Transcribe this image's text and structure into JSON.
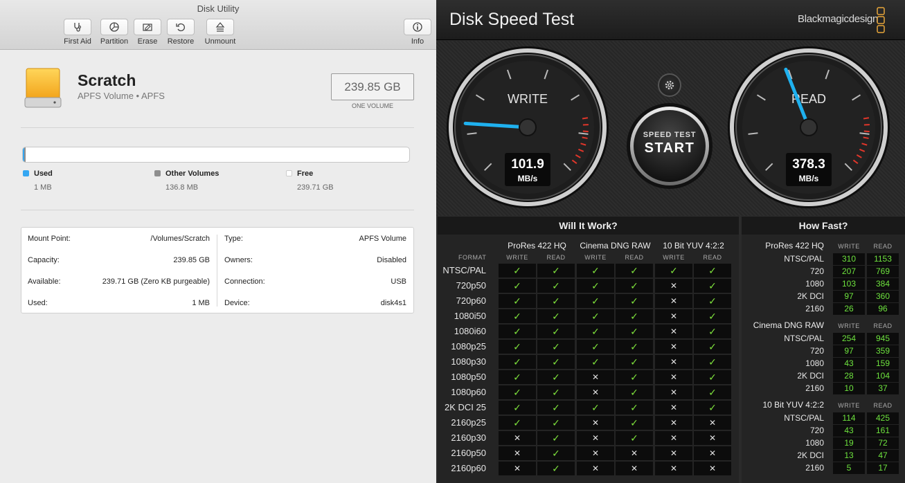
{
  "disk_utility": {
    "window_title": "Disk Utility",
    "toolbar": [
      {
        "label": "First Aid",
        "icon": "stethoscope-icon"
      },
      {
        "label": "Partition",
        "icon": "pie-icon"
      },
      {
        "label": "Erase",
        "icon": "erase-icon"
      },
      {
        "label": "Restore",
        "icon": "restore-icon"
      },
      {
        "label": "Unmount",
        "icon": "eject-icon"
      },
      {
        "label": "Info",
        "icon": "info-icon"
      }
    ],
    "volume": {
      "name": "Scratch",
      "subtitle": "APFS Volume • APFS",
      "size": "239.85 GB",
      "size_caption": "ONE VOLUME"
    },
    "usage": {
      "used_fraction": 0.003,
      "other_fraction": 0.004,
      "colors": {
        "used": "#35a7f2",
        "other": "#8e8e8e",
        "free": "#ffffff"
      },
      "legend": [
        {
          "label": "Used",
          "value": "1 MB"
        },
        {
          "label": "Other Volumes",
          "value": "136.8 MB"
        },
        {
          "label": "Free",
          "value": "239.71 GB"
        }
      ]
    },
    "info": {
      "left": [
        {
          "key": "Mount Point:",
          "value": "/Volumes/Scratch"
        },
        {
          "key": "Capacity:",
          "value": "239.85 GB"
        },
        {
          "key": "Available:",
          "value": "239.71 GB (Zero KB purgeable)"
        },
        {
          "key": "Used:",
          "value": "1 MB"
        }
      ],
      "right": [
        {
          "key": "Type:",
          "value": "APFS Volume"
        },
        {
          "key": "Owners:",
          "value": "Disabled"
        },
        {
          "key": "Connection:",
          "value": "USB"
        },
        {
          "key": "Device:",
          "value": "disk4s1"
        }
      ]
    }
  },
  "speed_test": {
    "title": "Disk Speed Test",
    "brand": "Blackmagicdesign",
    "accent_color": "#1fb1ef",
    "write_gauge": {
      "label": "WRITE",
      "value": "101.9",
      "unit": "MB/s",
      "fraction": 0.18
    },
    "read_gauge": {
      "label": "READ",
      "value": "378.3",
      "unit": "MB/s",
      "fraction": 0.42
    },
    "start_button": {
      "small": "SPEED TEST",
      "big": "START"
    },
    "will_it_work": {
      "title": "Will It Work?",
      "format_header": "FORMAT",
      "write_header": "WRITE",
      "read_header": "READ",
      "groups": [
        "ProRes 422 HQ",
        "Cinema DNG RAW",
        "10 Bit YUV 4:2:2"
      ],
      "rows": [
        {
          "format": "NTSC/PAL",
          "checks": [
            1,
            1,
            1,
            1,
            1,
            1
          ]
        },
        {
          "format": "720p50",
          "checks": [
            1,
            1,
            1,
            1,
            0,
            1
          ]
        },
        {
          "format": "720p60",
          "checks": [
            1,
            1,
            1,
            1,
            0,
            1
          ]
        },
        {
          "format": "1080i50",
          "checks": [
            1,
            1,
            1,
            1,
            0,
            1
          ]
        },
        {
          "format": "1080i60",
          "checks": [
            1,
            1,
            1,
            1,
            0,
            1
          ]
        },
        {
          "format": "1080p25",
          "checks": [
            1,
            1,
            1,
            1,
            0,
            1
          ]
        },
        {
          "format": "1080p30",
          "checks": [
            1,
            1,
            1,
            1,
            0,
            1
          ]
        },
        {
          "format": "1080p50",
          "checks": [
            1,
            1,
            0,
            1,
            0,
            1
          ]
        },
        {
          "format": "1080p60",
          "checks": [
            1,
            1,
            0,
            1,
            0,
            1
          ]
        },
        {
          "format": "2K DCI 25",
          "checks": [
            1,
            1,
            1,
            1,
            0,
            1
          ]
        },
        {
          "format": "2160p25",
          "checks": [
            1,
            1,
            0,
            1,
            0,
            0
          ]
        },
        {
          "format": "2160p30",
          "checks": [
            0,
            1,
            0,
            1,
            0,
            0
          ]
        },
        {
          "format": "2160p50",
          "checks": [
            0,
            1,
            0,
            0,
            0,
            0
          ]
        },
        {
          "format": "2160p60",
          "checks": [
            0,
            1,
            0,
            0,
            0,
            0
          ]
        }
      ],
      "check_symbol": "✓",
      "cross_symbol": "✕"
    },
    "how_fast": {
      "title": "How Fast?",
      "write_header": "WRITE",
      "read_header": "READ",
      "groups": [
        {
          "name": "ProRes 422 HQ",
          "rows": [
            {
              "format": "NTSC/PAL",
              "write": "310",
              "read": "1153"
            },
            {
              "format": "720",
              "write": "207",
              "read": "769"
            },
            {
              "format": "1080",
              "write": "103",
              "read": "384"
            },
            {
              "format": "2K DCI",
              "write": "97",
              "read": "360"
            },
            {
              "format": "2160",
              "write": "26",
              "read": "96"
            }
          ]
        },
        {
          "name": "Cinema DNG RAW",
          "rows": [
            {
              "format": "NTSC/PAL",
              "write": "254",
              "read": "945"
            },
            {
              "format": "720",
              "write": "97",
              "read": "359"
            },
            {
              "format": "1080",
              "write": "43",
              "read": "159"
            },
            {
              "format": "2K DCI",
              "write": "28",
              "read": "104"
            },
            {
              "format": "2160",
              "write": "10",
              "read": "37"
            }
          ]
        },
        {
          "name": "10 Bit YUV 4:2:2",
          "rows": [
            {
              "format": "NTSC/PAL",
              "write": "114",
              "read": "425"
            },
            {
              "format": "720",
              "write": "43",
              "read": "161"
            },
            {
              "format": "1080",
              "write": "19",
              "read": "72"
            },
            {
              "format": "2K DCI",
              "write": "13",
              "read": "47"
            },
            {
              "format": "2160",
              "write": "5",
              "read": "17"
            }
          ]
        }
      ]
    }
  }
}
